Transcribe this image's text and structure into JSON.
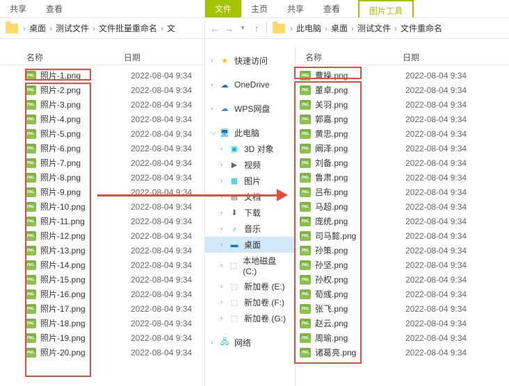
{
  "left": {
    "ribbon": [
      "共享",
      "查看"
    ],
    "breadcrumb": [
      "桌面",
      "测试文件",
      "文件批量重命名",
      "文"
    ],
    "columns": {
      "name": "名称",
      "date": "日期"
    },
    "files": [
      {
        "name": "照片-1.png",
        "date": "2022-08-04 9:34"
      },
      {
        "name": "照片-2.png",
        "date": "2022-08-04 9:34"
      },
      {
        "name": "照片-3.png",
        "date": "2022-08-04 9:34"
      },
      {
        "name": "照片-4.png",
        "date": "2022-08-04 9:34"
      },
      {
        "name": "照片-5.png",
        "date": "2022-08-04 9:34"
      },
      {
        "name": "照片-6.png",
        "date": "2022-08-04 9:34"
      },
      {
        "name": "照片-7.png",
        "date": "2022-08-04 9:34"
      },
      {
        "name": "照片-8.png",
        "date": "2022-08-04 9:34"
      },
      {
        "name": "照片-9.png",
        "date": "2022-08-04 9:34"
      },
      {
        "name": "照片-10.png",
        "date": "2022-08-04 9:34"
      },
      {
        "name": "照片-11.png",
        "date": "2022-08-04 9:34"
      },
      {
        "name": "照片-12.png",
        "date": "2022-08-04 9:34"
      },
      {
        "name": "照片-13.png",
        "date": "2022-08-04 9:34"
      },
      {
        "name": "照片-14.png",
        "date": "2022-08-04 9:34"
      },
      {
        "name": "照片-15.png",
        "date": "2022-08-04 9:34"
      },
      {
        "name": "照片-16.png",
        "date": "2022-08-04 9:34"
      },
      {
        "name": "照片-17.png",
        "date": "2022-08-04 9:34"
      },
      {
        "name": "照片-18.png",
        "date": "2022-08-04 9:34"
      },
      {
        "name": "照片-19.png",
        "date": "2022-08-04 9:34"
      },
      {
        "name": "照片-20.png",
        "date": "2022-08-04 9:34"
      }
    ]
  },
  "right": {
    "ribbon": [
      {
        "label": "文件",
        "active": true
      },
      {
        "label": "主页"
      },
      {
        "label": "共享"
      },
      {
        "label": "查看"
      }
    ],
    "tool_tab": "图片工具",
    "breadcrumb": [
      "此电脑",
      "桌面",
      "测试文件",
      "文件重命名"
    ],
    "columns": {
      "name": "名称",
      "date": "日期"
    },
    "sidebar": {
      "quick": "快速访问",
      "onedrive": "OneDrive",
      "wps": "WPS网盘",
      "pc": "此电脑",
      "items": [
        {
          "label": "3D 对象"
        },
        {
          "label": "视频"
        },
        {
          "label": "图片"
        },
        {
          "label": "文档"
        },
        {
          "label": "下载"
        },
        {
          "label": "音乐"
        },
        {
          "label": "桌面",
          "active": true
        },
        {
          "label": "本地磁盘 (C:)"
        },
        {
          "label": "新加卷 (E:)"
        },
        {
          "label": "新加卷 (F:)"
        },
        {
          "label": "新加卷 (G:)"
        }
      ],
      "network": "网络"
    },
    "files": [
      {
        "name": "曹操.png",
        "date": "2022-08-04 9:34"
      },
      {
        "name": "董卓.png",
        "date": "2022-08-04 9:34"
      },
      {
        "name": "关羽.png",
        "date": "2022-08-04 9:34"
      },
      {
        "name": "郭嘉.png",
        "date": "2022-08-04 9:34"
      },
      {
        "name": "黄忠.png",
        "date": "2022-08-04 9:34"
      },
      {
        "name": "阚泽.png",
        "date": "2022-08-04 9:34"
      },
      {
        "name": "刘备.png",
        "date": "2022-08-04 9:34"
      },
      {
        "name": "鲁肃.png",
        "date": "2022-08-04 9:34"
      },
      {
        "name": "吕布.png",
        "date": "2022-08-04 9:34"
      },
      {
        "name": "马超.png",
        "date": "2022-08-04 9:34"
      },
      {
        "name": "庞统.png",
        "date": "2022-08-04 9:34"
      },
      {
        "name": "司马懿.png",
        "date": "2022-08-04 9:34"
      },
      {
        "name": "孙策.png",
        "date": "2022-08-04 9:34"
      },
      {
        "name": "孙坚.png",
        "date": "2022-08-04 9:34"
      },
      {
        "name": "孙权.png",
        "date": "2022-08-04 9:34"
      },
      {
        "name": "荀彧.png",
        "date": "2022-08-04 9:34"
      },
      {
        "name": "张飞.png",
        "date": "2022-08-04 9:34"
      },
      {
        "name": "赵云.png",
        "date": "2022-08-04 9:34"
      },
      {
        "name": "周瑜.png",
        "date": "2022-08-04 9:34"
      },
      {
        "name": "诸葛亮.png",
        "date": "2022-08-04 9:34"
      }
    ]
  }
}
